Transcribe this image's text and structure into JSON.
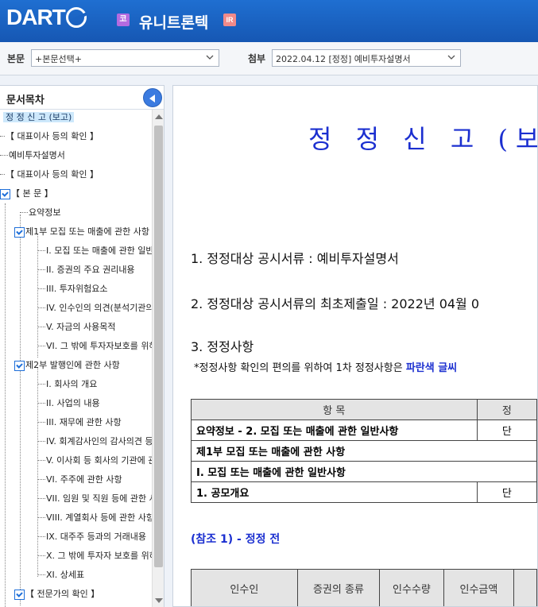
{
  "header": {
    "logo": "DART",
    "corp_badge": "코",
    "corp_name": "유니트론텍",
    "ir_badge": "IR"
  },
  "selectors": {
    "main_label": "본문",
    "main_value": "+본문선택+",
    "attach_label": "첨부",
    "attach_value": "2022.04.12 [정정] 예비투자설명서"
  },
  "sidebar": {
    "title": "문서목차",
    "items": [
      {
        "label": "정 정 신 고 (보고)"
      },
      {
        "label": "【 대표이사 등의 확인 】"
      },
      {
        "label": "예비투자설명서"
      },
      {
        "label": "【 대표이사 등의 확인 】"
      },
      {
        "label": "【 본 문 】"
      },
      {
        "label": "요약정보"
      },
      {
        "label": "제1부 모집 또는 매출에 관한 사항"
      },
      {
        "label": "I. 모집 또는 매출에 관한 일반사항"
      },
      {
        "label": "II. 증권의 주요 권리내용"
      },
      {
        "label": "III. 투자위험요소"
      },
      {
        "label": "IV. 인수인의 의견(분석기관의 평가의견)"
      },
      {
        "label": "V. 자금의 사용목적"
      },
      {
        "label": "VI. 그 밖에 투자자보호를 위해 필요한 사항"
      },
      {
        "label": "제2부 발행인에 관한 사항"
      },
      {
        "label": "I. 회사의 개요"
      },
      {
        "label": "II. 사업의 내용"
      },
      {
        "label": "III. 재무에 관한 사항"
      },
      {
        "label": "IV. 회계감사인의 감사의견 등"
      },
      {
        "label": "V. 이사회 등 회사의 기관에 관한 사항"
      },
      {
        "label": "VI. 주주에 관한 사항"
      },
      {
        "label": "VII. 임원 및 직원 등에 관한 사항"
      },
      {
        "label": "VIII. 계열회사 등에 관한 사항"
      },
      {
        "label": "IX. 대주주 등과의 거래내용"
      },
      {
        "label": "X. 그 밖에 투자자 보호를 위하여 필요한 사항"
      },
      {
        "label": "XI. 상세표"
      },
      {
        "label": "【 전문가의 확인 】"
      }
    ]
  },
  "document": {
    "title": "정 정 신 고 (보고)",
    "line1": "1. 정정대상 공시서류 : 예비투자설명서",
    "line2": "2. 정정대상 공시서류의 최초제출일 : 2022년 04월 0",
    "line3": "3. 정정사항",
    "note_prefix": "*정정사항 확인의 편의를 위하여 1차 정정사항은 ",
    "note_emph": "파란색 글씨",
    "table": {
      "header_item": "항 목",
      "header_right": "정",
      "rows": [
        {
          "item": "요약정보 - 2. 모집 또는 매출에 관한 일반사항",
          "right": "단"
        },
        {
          "item": "제1부 모집 또는 매출에 관한 사항",
          "right": ""
        },
        {
          "item": "I. 모집 또는 매출에 관한 일반사항",
          "right": ""
        },
        {
          "item": "1. 공모개요",
          "right": "단"
        }
      ]
    },
    "reference": "(참조 1) - 정정 전",
    "table2_headers": [
      "인수인",
      "증권의 종류",
      "인수수량",
      "인수금액"
    ]
  }
}
